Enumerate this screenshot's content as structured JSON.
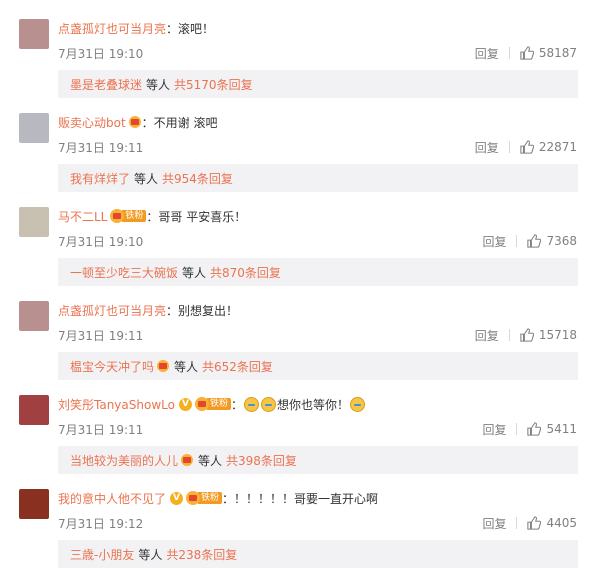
{
  "comments": [
    {
      "username": "点盏孤灯也可当月亮",
      "text": "：滚吧！",
      "time": "7月31日 19:10",
      "reply_label": "回复",
      "likes": "58187",
      "avatar_color": "#b89090",
      "sub_user": "墨是老叠球迷",
      "sub_mid": "等人",
      "sub_total": "共5170条回复"
    },
    {
      "username": "贩卖心动bot",
      "text": "：不用谢 滚吧",
      "time": "7月31日 19:11",
      "reply_label": "回复",
      "likes": "22871",
      "avatar_color": "#b8b8c0",
      "sub_user": "我有烊烊了",
      "sub_mid": "等人",
      "sub_total": "共954条回复"
    },
    {
      "username": "马不二LL",
      "fan_label": "铁粉",
      "text": "：哥哥 平安喜乐！",
      "time": "7月31日 19:10",
      "reply_label": "回复",
      "likes": "7368",
      "avatar_color": "#c8c0b0",
      "sub_user": "一顿至少吃三大碗饭",
      "sub_mid": "等人",
      "sub_total": "共870条回复"
    },
    {
      "username": "点盏孤灯也可当月亮",
      "text": "：别想复出！",
      "time": "7月31日 19:11",
      "reply_label": "回复",
      "likes": "15718",
      "avatar_color": "#b89090",
      "sub_user": "榅宝今天冲了吗",
      "sub_mid": "等人",
      "sub_total": "共652条回复"
    },
    {
      "username": "刘笑彤TanyaShowLo",
      "fan_label": "铁粉",
      "text_mid": "想你也等你！",
      "time": "7月31日 19:11",
      "reply_label": "回复",
      "likes": "5411",
      "avatar_color": "#a04040",
      "sub_user": "当地较为美丽的人儿",
      "sub_mid": "等人",
      "sub_total": "共398条回复"
    },
    {
      "username": "我的意中人他不见了",
      "fan_label": "铁粉",
      "text": "：！！！！！哥要一直开心啊",
      "time": "7月31日 19:12",
      "reply_label": "回复",
      "likes": "4405",
      "avatar_color": "#8a3020",
      "sub_user": "三歳-小朋友",
      "sub_mid": "等人",
      "sub_total": "共238条回复"
    }
  ]
}
